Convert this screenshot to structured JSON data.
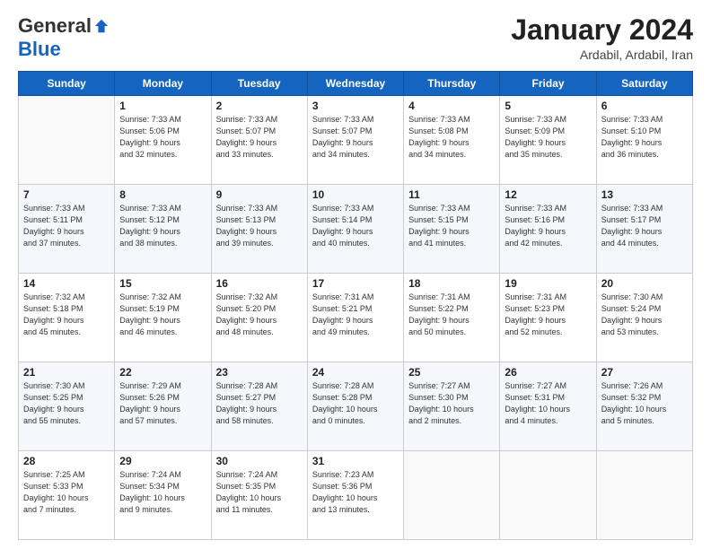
{
  "header": {
    "logo": {
      "general": "General",
      "blue": "Blue"
    },
    "title": "January 2024",
    "subtitle": "Ardabil, Ardabil, Iran"
  },
  "weekdays": [
    "Sunday",
    "Monday",
    "Tuesday",
    "Wednesday",
    "Thursday",
    "Friday",
    "Saturday"
  ],
  "weeks": [
    [
      {
        "day": "",
        "info": ""
      },
      {
        "day": "1",
        "info": "Sunrise: 7:33 AM\nSunset: 5:06 PM\nDaylight: 9 hours\nand 32 minutes."
      },
      {
        "day": "2",
        "info": "Sunrise: 7:33 AM\nSunset: 5:07 PM\nDaylight: 9 hours\nand 33 minutes."
      },
      {
        "day": "3",
        "info": "Sunrise: 7:33 AM\nSunset: 5:07 PM\nDaylight: 9 hours\nand 34 minutes."
      },
      {
        "day": "4",
        "info": "Sunrise: 7:33 AM\nSunset: 5:08 PM\nDaylight: 9 hours\nand 34 minutes."
      },
      {
        "day": "5",
        "info": "Sunrise: 7:33 AM\nSunset: 5:09 PM\nDaylight: 9 hours\nand 35 minutes."
      },
      {
        "day": "6",
        "info": "Sunrise: 7:33 AM\nSunset: 5:10 PM\nDaylight: 9 hours\nand 36 minutes."
      }
    ],
    [
      {
        "day": "7",
        "info": "Sunrise: 7:33 AM\nSunset: 5:11 PM\nDaylight: 9 hours\nand 37 minutes."
      },
      {
        "day": "8",
        "info": "Sunrise: 7:33 AM\nSunset: 5:12 PM\nDaylight: 9 hours\nand 38 minutes."
      },
      {
        "day": "9",
        "info": "Sunrise: 7:33 AM\nSunset: 5:13 PM\nDaylight: 9 hours\nand 39 minutes."
      },
      {
        "day": "10",
        "info": "Sunrise: 7:33 AM\nSunset: 5:14 PM\nDaylight: 9 hours\nand 40 minutes."
      },
      {
        "day": "11",
        "info": "Sunrise: 7:33 AM\nSunset: 5:15 PM\nDaylight: 9 hours\nand 41 minutes."
      },
      {
        "day": "12",
        "info": "Sunrise: 7:33 AM\nSunset: 5:16 PM\nDaylight: 9 hours\nand 42 minutes."
      },
      {
        "day": "13",
        "info": "Sunrise: 7:33 AM\nSunset: 5:17 PM\nDaylight: 9 hours\nand 44 minutes."
      }
    ],
    [
      {
        "day": "14",
        "info": "Sunrise: 7:32 AM\nSunset: 5:18 PM\nDaylight: 9 hours\nand 45 minutes."
      },
      {
        "day": "15",
        "info": "Sunrise: 7:32 AM\nSunset: 5:19 PM\nDaylight: 9 hours\nand 46 minutes."
      },
      {
        "day": "16",
        "info": "Sunrise: 7:32 AM\nSunset: 5:20 PM\nDaylight: 9 hours\nand 48 minutes."
      },
      {
        "day": "17",
        "info": "Sunrise: 7:31 AM\nSunset: 5:21 PM\nDaylight: 9 hours\nand 49 minutes."
      },
      {
        "day": "18",
        "info": "Sunrise: 7:31 AM\nSunset: 5:22 PM\nDaylight: 9 hours\nand 50 minutes."
      },
      {
        "day": "19",
        "info": "Sunrise: 7:31 AM\nSunset: 5:23 PM\nDaylight: 9 hours\nand 52 minutes."
      },
      {
        "day": "20",
        "info": "Sunrise: 7:30 AM\nSunset: 5:24 PM\nDaylight: 9 hours\nand 53 minutes."
      }
    ],
    [
      {
        "day": "21",
        "info": "Sunrise: 7:30 AM\nSunset: 5:25 PM\nDaylight: 9 hours\nand 55 minutes."
      },
      {
        "day": "22",
        "info": "Sunrise: 7:29 AM\nSunset: 5:26 PM\nDaylight: 9 hours\nand 57 minutes."
      },
      {
        "day": "23",
        "info": "Sunrise: 7:28 AM\nSunset: 5:27 PM\nDaylight: 9 hours\nand 58 minutes."
      },
      {
        "day": "24",
        "info": "Sunrise: 7:28 AM\nSunset: 5:28 PM\nDaylight: 10 hours\nand 0 minutes."
      },
      {
        "day": "25",
        "info": "Sunrise: 7:27 AM\nSunset: 5:30 PM\nDaylight: 10 hours\nand 2 minutes."
      },
      {
        "day": "26",
        "info": "Sunrise: 7:27 AM\nSunset: 5:31 PM\nDaylight: 10 hours\nand 4 minutes."
      },
      {
        "day": "27",
        "info": "Sunrise: 7:26 AM\nSunset: 5:32 PM\nDaylight: 10 hours\nand 5 minutes."
      }
    ],
    [
      {
        "day": "28",
        "info": "Sunrise: 7:25 AM\nSunset: 5:33 PM\nDaylight: 10 hours\nand 7 minutes."
      },
      {
        "day": "29",
        "info": "Sunrise: 7:24 AM\nSunset: 5:34 PM\nDaylight: 10 hours\nand 9 minutes."
      },
      {
        "day": "30",
        "info": "Sunrise: 7:24 AM\nSunset: 5:35 PM\nDaylight: 10 hours\nand 11 minutes."
      },
      {
        "day": "31",
        "info": "Sunrise: 7:23 AM\nSunset: 5:36 PM\nDaylight: 10 hours\nand 13 minutes."
      },
      {
        "day": "",
        "info": ""
      },
      {
        "day": "",
        "info": ""
      },
      {
        "day": "",
        "info": ""
      }
    ]
  ]
}
